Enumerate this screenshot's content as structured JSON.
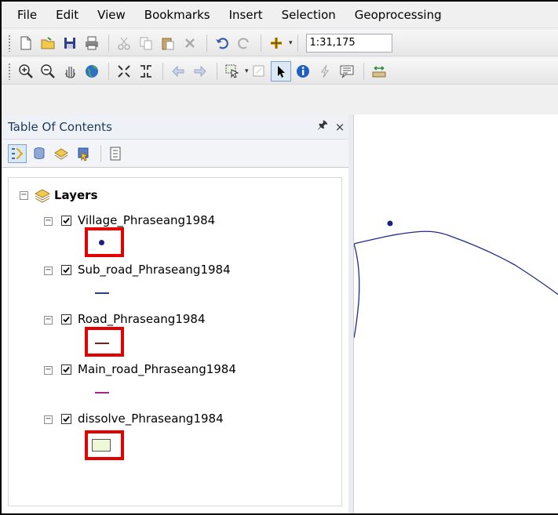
{
  "menubar": {
    "items": [
      "File",
      "Edit",
      "View",
      "Bookmarks",
      "Insert",
      "Selection",
      "Geoprocessing"
    ]
  },
  "toolbar": {
    "scale_value": "1:31,175"
  },
  "toc": {
    "title": "Table Of Contents",
    "pin_glyph": "♒",
    "close_glyph": "×",
    "group": {
      "label": "Layers",
      "expander": "−"
    },
    "layers": [
      {
        "name": "Village_Phraseang1984",
        "checked": true,
        "symbol": "point",
        "color": "#1f1f8a"
      },
      {
        "name": "Sub_road_Phraseang1984",
        "checked": true,
        "symbol": "line",
        "color": "#2b3a9b"
      },
      {
        "name": "Road_Phraseang1984",
        "checked": true,
        "symbol": "line",
        "color": "#8b1a1a"
      },
      {
        "name": "Main_road_Phraseang1984",
        "checked": true,
        "symbol": "line",
        "color": "#9b2c84"
      },
      {
        "name": "dissolve_Phraseang1984",
        "checked": true,
        "symbol": "polygon",
        "color": "#eef7d6"
      }
    ]
  },
  "highlight_color": "#e30000",
  "map": {
    "feature_color": "#1f2a8a"
  }
}
